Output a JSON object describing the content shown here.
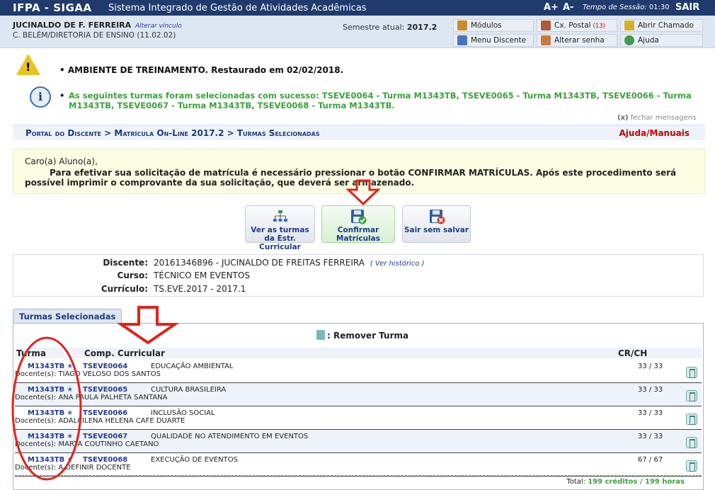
{
  "header": {
    "system": "IFPA - SIGAA",
    "system_name": "Sistema Integrado de Gestão de Atividades Acadêmicas",
    "font_plus": "A+",
    "font_minus": "A-",
    "session_label": "Tempo de Sessão:",
    "session_time": "01:30",
    "logout": "SAIR"
  },
  "user": {
    "name": "JUCINALDO DE F. FERREIRA",
    "change_link": "Alterar vínculo",
    "dept": "C. BELÉM/DIRETORIA DE ENSINO (11.02.02)",
    "semester_label": "Semestre atual:",
    "semester": "2017.2"
  },
  "menu": {
    "modulos": "Módulos",
    "cx_postal": "Cx. Postal",
    "cx_postal_count": "(13)",
    "abrir_chamado": "Abrir Chamado",
    "menu_discente": "Menu Discente",
    "alterar_senha": "Alterar senha",
    "ajuda": "Ajuda"
  },
  "messages": {
    "warning": "AMBIENTE DE TREINAMENTO. Restaurado em 02/02/2018.",
    "success": "As seguintes turmas foram selecionadas com sucesso: TSEVE0064 - Turma M1343TB, TSEVE0065 - Turma M1343TB, TSEVE0066 - Turma M1343TB, TSEVE0067 - Turma M1343TB, TSEVE0068 - Turma M1343TB.",
    "close_x": "(x)",
    "close_label": "fechar mensagens"
  },
  "breadcrumb": {
    "path": "Portal do Discente > Matrícula On-Line 2017.2 > Turmas Selecionadas",
    "help": "Ajuda/Manuais"
  },
  "notice": {
    "greeting": "Caro(a) Aluno(a),",
    "text": "Para efetivar sua solicitação de matrícula é necessário pressionar o botão CONFIRMAR MATRÍCULAS. Após este procedimento será possível imprimir o comprovante da sua solicitação, que deverá ser armazenado."
  },
  "actions": {
    "ver_turmas": "Ver as turmas da Estr. Curricular",
    "confirmar": "Confirmar Matrículas",
    "sair": "Sair sem salvar"
  },
  "student": {
    "discente_label": "Discente:",
    "discente": "20161346896 - JUCINALDO DE FREITAS FERREIRA",
    "historico_link": "( Ver histórico )",
    "curso_label": "Curso:",
    "curso": "TÉCNICO EM EVENTOS",
    "curriculo_label": "Currículo:",
    "curriculo": "TS.EVE.2017 - 2017.1"
  },
  "table": {
    "tab_label": "Turmas Selecionadas",
    "legend": ": Remover Turma",
    "col_turma": "Turma",
    "col_comp": "Comp. Curricular",
    "col_crch": "CR/CH",
    "docente_prefix": "Docente(s):",
    "rows": [
      {
        "turma": "M1343TB",
        "codigo": "TSEVE0064",
        "nome": "EDUCAÇÃO AMBIENTAL",
        "docente": "Docente(s): TIAGO VELOSO DOS SANTOS",
        "crch": "33 / 33"
      },
      {
        "turma": "M1343TB",
        "codigo": "TSEVE0065",
        "nome": "CULTURA BRASILEIRA",
        "docente": "Docente(s): ANA PAULA PALHETA SANTANA",
        "crch": "33 / 33"
      },
      {
        "turma": "M1343TB",
        "codigo": "TSEVE0066",
        "nome": "INCLUSÃO SOCIAL",
        "docente": "Docente(s): ADALCILENA HELENA CAFE DUARTE",
        "crch": "33 / 33"
      },
      {
        "turma": "M1343TB",
        "codigo": "TSEVE0067",
        "nome": "QUALIDADE NO ATENDIMENTO EM EVENTOS",
        "docente": "Docente(s): MARTA COUTINHO CAETANO",
        "crch": "33 / 33"
      },
      {
        "turma": "M1343TB",
        "codigo": "TSEVE0068",
        "nome": "EXECUÇÃO DE EVENTOS",
        "docente": "Docente(s): A DEFINIR DOCENTE",
        "crch": "67 / 67"
      }
    ],
    "total_label": "Total:",
    "total_value": "199 créditos / 199 horas"
  },
  "colors": {
    "topbar": "#1f3a6d",
    "link": "#1f3a9d",
    "success": "#3aa23a",
    "help": "#c40000",
    "annotation": "#e0231c"
  }
}
